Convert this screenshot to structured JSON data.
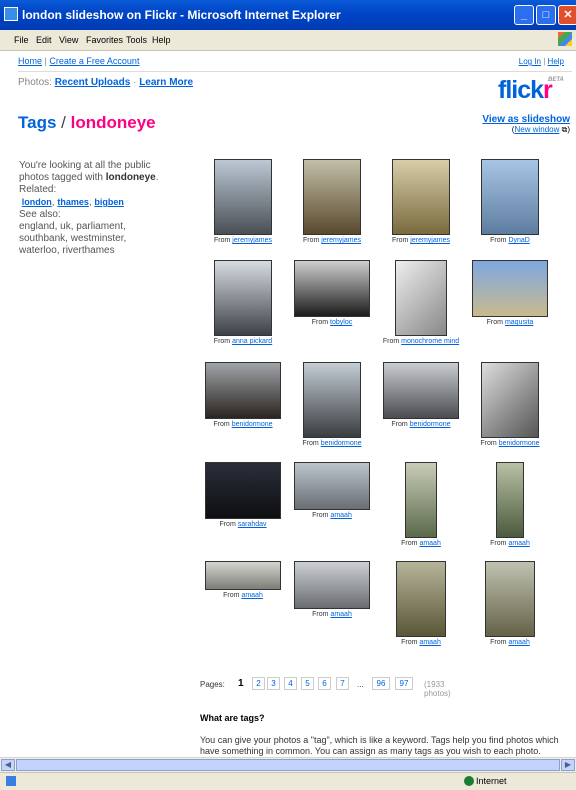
{
  "window": {
    "title": "london slideshow on Flickr - Microsoft Internet Explorer"
  },
  "menu": [
    "File",
    "Edit",
    "View",
    "Favorites",
    "Tools",
    "Help"
  ],
  "topnav": {
    "home": "Home",
    "sep": "|",
    "create": "Create a Free Account",
    "login": "Log In",
    "help": "Help"
  },
  "photos": {
    "label": "Photos:",
    "recent": "Recent Uploads",
    "dot": "·",
    "learn": "Learn More"
  },
  "logo": {
    "part1": "flick",
    "part2": "r",
    "beta": "BETA"
  },
  "heading": {
    "tags": "Tags",
    "slash": "/",
    "tag": "londoneye"
  },
  "slideshow": {
    "link": "View as slideshow",
    "open": "(",
    "newwin": "New window",
    "close": ")"
  },
  "sidebar": {
    "intro1": "You're looking at all the public photos tagged with",
    "tag": "londoneye",
    "period": ".",
    "related_label": "Related:",
    "related": [
      "london",
      "thames",
      "bigben"
    ],
    "seealso_label": "See also:",
    "seealso": [
      "england",
      "uk",
      "parliament",
      "southbank",
      "westminster",
      "waterloo",
      "riverthames"
    ]
  },
  "from_label": "From",
  "thumbnails": [
    {
      "user": "jeremyjames"
    },
    {
      "user": "jeremyjames"
    },
    {
      "user": "jeremyjames"
    },
    {
      "user": "DynaD"
    },
    {
      "user": "anna pickard"
    },
    {
      "user": "tobyloc"
    },
    {
      "user": "monochrome mind"
    },
    {
      "user": "maqusita"
    },
    {
      "user": "benidormone"
    },
    {
      "user": "benidormone"
    },
    {
      "user": "benidormone"
    },
    {
      "user": "benidormone"
    },
    {
      "user": "sarahdav"
    },
    {
      "user": "amaah"
    },
    {
      "user": "amaah"
    },
    {
      "user": "amaah"
    },
    {
      "user": "amaah"
    },
    {
      "user": "amaah"
    },
    {
      "user": "amaah"
    },
    {
      "user": "amaah"
    }
  ],
  "pager": {
    "label": "Pages:",
    "current": "1",
    "pages": [
      "2",
      "3",
      "4",
      "5",
      "6",
      "7"
    ],
    "dots": "...",
    "pages_end": [
      "96",
      "97"
    ],
    "count": "(1933 photos)"
  },
  "what_tags": "What are tags?",
  "tags_expl": "You can give your photos a \"tag\", which is like a keyword. Tags help you find photos which have something in common. You can assign as many tags as you wish to each photo.",
  "status": {
    "zone": "Internet"
  }
}
